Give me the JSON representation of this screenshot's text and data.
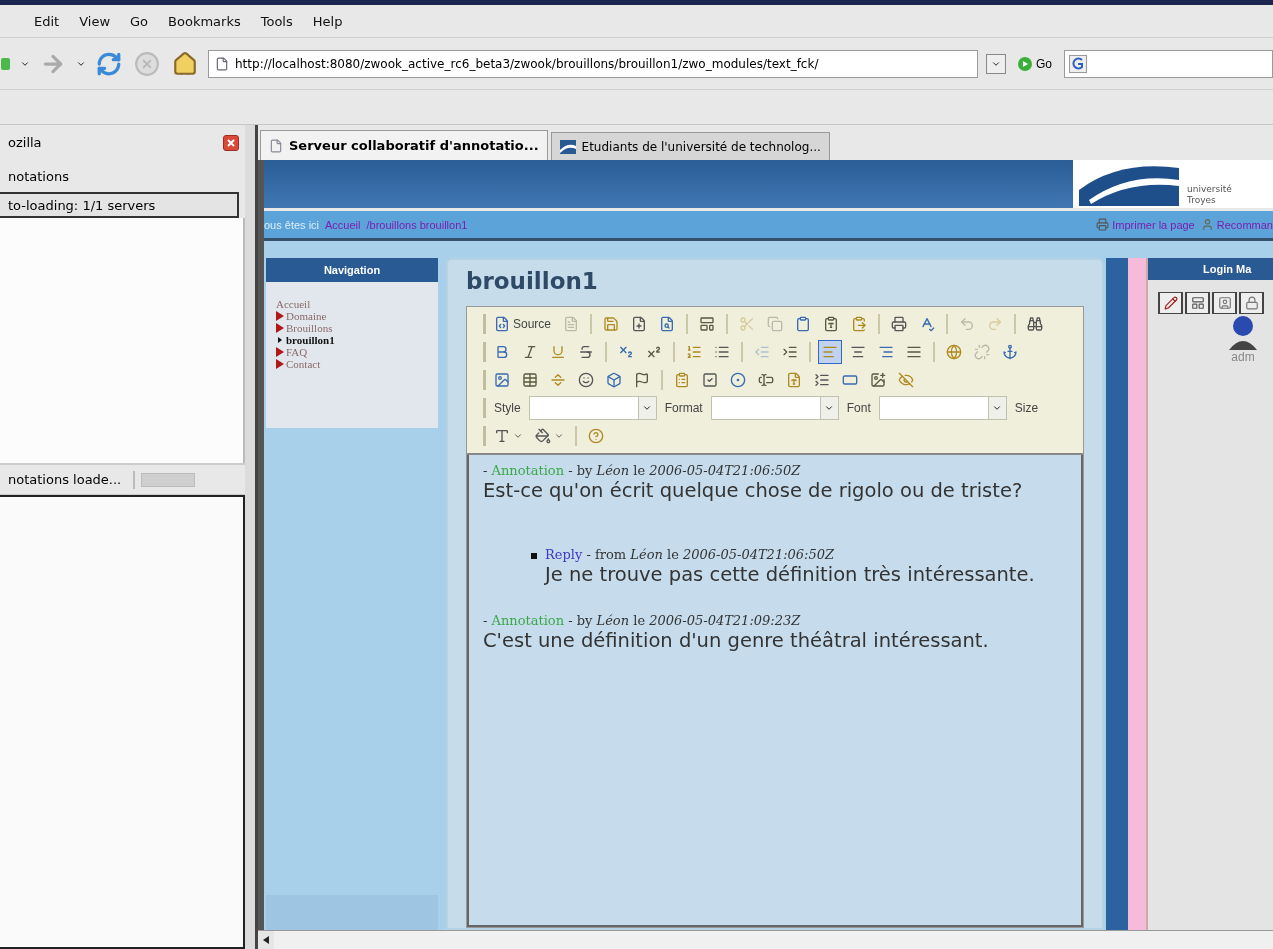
{
  "menu": [
    "Edit",
    "View",
    "Go",
    "Bookmarks",
    "Tools",
    "Help"
  ],
  "navbar": {
    "url": "http://localhost:8080/zwook_active_rc6_beta3/zwook/brouillons/brouillon1/zwo_modules/text_fck/",
    "go": "Go"
  },
  "sidebar": {
    "title": "ozilla",
    "section": "notations",
    "status": "to-loading: 1/1 servers",
    "statusbar": "notations loade..."
  },
  "tabs": [
    {
      "label": "Serveur collaboratif d'annotatio...",
      "selected": true
    },
    {
      "label": "Etudiants de l'université de technolog...",
      "selected": false
    }
  ],
  "banner": {
    "logo_lines": [
      "université",
      "Troyes"
    ]
  },
  "breadcrumb": {
    "intro": "ous êtes ici",
    "links": [
      "Accueil",
      "/brouillons brouillon1"
    ],
    "actions": [
      {
        "kind": "print",
        "label": "Imprimer la page"
      },
      {
        "kind": "recommend",
        "label": "Recomman"
      }
    ]
  },
  "navigation": {
    "title": "Navigation",
    "items": [
      {
        "label": "Accueil",
        "kind": "plain",
        "selected": false
      },
      {
        "label": "Domaine",
        "kind": "section",
        "selected": false
      },
      {
        "label": "Brouillons",
        "kind": "section",
        "selected": false
      },
      {
        "label": "brouillon1",
        "kind": "page",
        "selected": true
      },
      {
        "label": "FAQ",
        "kind": "section",
        "selected": false
      },
      {
        "label": "Contact",
        "kind": "section",
        "selected": false
      }
    ]
  },
  "page_title": "brouillon1",
  "editor": {
    "toolbar": [
      [
        {
          "kind": "button",
          "label": "Source",
          "disabled": false
        },
        {
          "kind": "button",
          "disabled": true
        },
        {
          "kind": "sep"
        },
        {
          "kind": "button",
          "disabled": false
        },
        {
          "kind": "button",
          "disabled": false
        },
        {
          "kind": "button",
          "disabled": false
        },
        {
          "kind": "sep"
        },
        {
          "kind": "button",
          "disabled": false
        },
        {
          "kind": "sep"
        },
        {
          "kind": "button",
          "disabled": true
        },
        {
          "kind": "button",
          "disabled": true
        },
        {
          "kind": "button",
          "disabled": false
        },
        {
          "kind": "button",
          "disabled": false
        },
        {
          "kind": "button",
          "disabled": false
        },
        {
          "kind": "sep"
        },
        {
          "kind": "button",
          "disabled": false
        },
        {
          "kind": "button",
          "disabled": false
        },
        {
          "kind": "sep"
        },
        {
          "kind": "button",
          "disabled": true
        },
        {
          "kind": "button",
          "disabled": true
        },
        {
          "kind": "sep"
        },
        {
          "kind": "button",
          "disabled": false
        }
      ],
      [
        {
          "kind": "button",
          "disabled": false,
          "selected": false
        },
        {
          "kind": "button",
          "disabled": false,
          "selected": false
        },
        {
          "kind": "button",
          "disabled": false,
          "selected": false
        },
        {
          "kind": "button",
          "disabled": false,
          "selected": false
        },
        {
          "kind": "sep"
        },
        {
          "kind": "button",
          "disabled": false,
          "selected": false
        },
        {
          "kind": "button",
          "disabled": false,
          "selected": false
        },
        {
          "kind": "sep"
        },
        {
          "kind": "button",
          "disabled": false,
          "selected": false
        },
        {
          "kind": "button",
          "disabled": false,
          "selected": false
        },
        {
          "kind": "sep"
        },
        {
          "kind": "button",
          "disabled": true,
          "selected": false
        },
        {
          "kind": "button",
          "disabled": false,
          "selected": false
        },
        {
          "kind": "sep"
        },
        {
          "kind": "button",
          "disabled": false,
          "selected": true
        },
        {
          "kind": "button",
          "disabled": false,
          "selected": false
        },
        {
          "kind": "button",
          "disabled": false,
          "selected": false
        },
        {
          "kind": "button",
          "disabled": false,
          "selected": false
        },
        {
          "kind": "sep"
        },
        {
          "kind": "button",
          "disabled": false,
          "selected": false
        },
        {
          "kind": "button",
          "disabled": true,
          "selected": false
        },
        {
          "kind": "button",
          "disabled": false,
          "selected": false
        }
      ],
      [
        {
          "kind": "button",
          "disabled": false
        },
        {
          "kind": "button",
          "disabled": false
        },
        {
          "kind": "button",
          "disabled": false
        },
        {
          "kind": "button",
          "disabled": false
        },
        {
          "kind": "button",
          "disabled": false
        },
        {
          "kind": "button",
          "disabled": false
        },
        {
          "kind": "sep"
        },
        {
          "kind": "button",
          "disabled": false
        },
        {
          "kind": "button",
          "disabled": false
        },
        {
          "kind": "button",
          "disabled": false
        },
        {
          "kind": "button",
          "disabled": false
        },
        {
          "kind": "button",
          "disabled": false
        },
        {
          "kind": "button",
          "disabled": false
        },
        {
          "kind": "button",
          "disabled": false
        },
        {
          "kind": "button",
          "disabled": false
        },
        {
          "kind": "button",
          "disabled": false
        }
      ],
      [
        {
          "kind": "combo",
          "label": "Style"
        },
        {
          "kind": "combo",
          "label": "Format"
        },
        {
          "kind": "combo",
          "label": "Font"
        },
        {
          "kind": "label",
          "label": "Size"
        }
      ],
      [
        {
          "kind": "menu",
          "disabled": false
        },
        {
          "kind": "menu",
          "disabled": false
        },
        {
          "kind": "sep"
        },
        {
          "kind": "button",
          "disabled": false
        }
      ]
    ],
    "annotations": [
      {
        "kind": "annotation",
        "prefix": "-",
        "label": "Annotation",
        "dash": "-",
        "verb": "by",
        "author": "Léon",
        "le": "le",
        "date": "2006-05-04T21:06:50Z",
        "text": "Est-ce qu'on écrit quelque chose de rigolo ou de triste?",
        "replies": [
          {
            "kind": "reply",
            "label": "Reply",
            "dash": "-",
            "verb": "from",
            "author": "Léon",
            "le": "le",
            "date": "2006-05-04T21:06:50Z",
            "text": "Je ne trouve pas cette définition très intéressante."
          }
        ]
      },
      {
        "kind": "annotation",
        "prefix": "-",
        "label": "Annotation",
        "dash": "-",
        "verb": "by",
        "author": "Léon",
        "le": "le",
        "date": "2006-05-04T21:09:23Z",
        "text": "C'est une définition d'un genre théâtral intéressant."
      }
    ]
  },
  "login": {
    "title": "Login Ma",
    "user": "adm"
  }
}
